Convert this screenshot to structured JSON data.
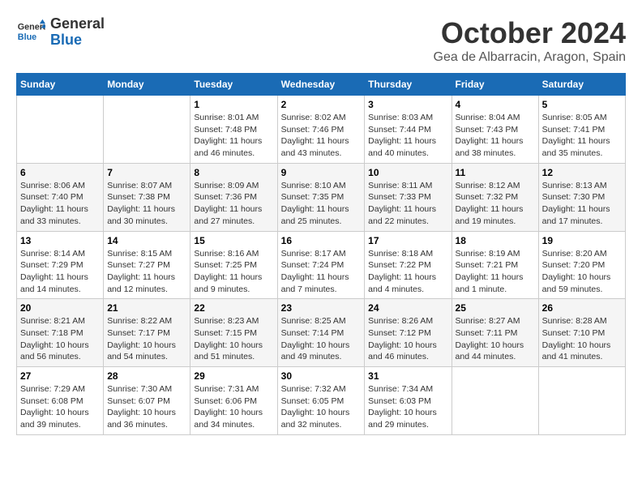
{
  "header": {
    "logo_general": "General",
    "logo_blue": "Blue",
    "month_title": "October 2024",
    "location": "Gea de Albarracin, Aragon, Spain"
  },
  "days_of_week": [
    "Sunday",
    "Monday",
    "Tuesday",
    "Wednesday",
    "Thursday",
    "Friday",
    "Saturday"
  ],
  "weeks": [
    [
      {
        "day": "",
        "info": ""
      },
      {
        "day": "",
        "info": ""
      },
      {
        "day": "1",
        "info": "Sunrise: 8:01 AM\nSunset: 7:48 PM\nDaylight: 11 hours and 46 minutes."
      },
      {
        "day": "2",
        "info": "Sunrise: 8:02 AM\nSunset: 7:46 PM\nDaylight: 11 hours and 43 minutes."
      },
      {
        "day": "3",
        "info": "Sunrise: 8:03 AM\nSunset: 7:44 PM\nDaylight: 11 hours and 40 minutes."
      },
      {
        "day": "4",
        "info": "Sunrise: 8:04 AM\nSunset: 7:43 PM\nDaylight: 11 hours and 38 minutes."
      },
      {
        "day": "5",
        "info": "Sunrise: 8:05 AM\nSunset: 7:41 PM\nDaylight: 11 hours and 35 minutes."
      }
    ],
    [
      {
        "day": "6",
        "info": "Sunrise: 8:06 AM\nSunset: 7:40 PM\nDaylight: 11 hours and 33 minutes."
      },
      {
        "day": "7",
        "info": "Sunrise: 8:07 AM\nSunset: 7:38 PM\nDaylight: 11 hours and 30 minutes."
      },
      {
        "day": "8",
        "info": "Sunrise: 8:09 AM\nSunset: 7:36 PM\nDaylight: 11 hours and 27 minutes."
      },
      {
        "day": "9",
        "info": "Sunrise: 8:10 AM\nSunset: 7:35 PM\nDaylight: 11 hours and 25 minutes."
      },
      {
        "day": "10",
        "info": "Sunrise: 8:11 AM\nSunset: 7:33 PM\nDaylight: 11 hours and 22 minutes."
      },
      {
        "day": "11",
        "info": "Sunrise: 8:12 AM\nSunset: 7:32 PM\nDaylight: 11 hours and 19 minutes."
      },
      {
        "day": "12",
        "info": "Sunrise: 8:13 AM\nSunset: 7:30 PM\nDaylight: 11 hours and 17 minutes."
      }
    ],
    [
      {
        "day": "13",
        "info": "Sunrise: 8:14 AM\nSunset: 7:29 PM\nDaylight: 11 hours and 14 minutes."
      },
      {
        "day": "14",
        "info": "Sunrise: 8:15 AM\nSunset: 7:27 PM\nDaylight: 11 hours and 12 minutes."
      },
      {
        "day": "15",
        "info": "Sunrise: 8:16 AM\nSunset: 7:25 PM\nDaylight: 11 hours and 9 minutes."
      },
      {
        "day": "16",
        "info": "Sunrise: 8:17 AM\nSunset: 7:24 PM\nDaylight: 11 hours and 7 minutes."
      },
      {
        "day": "17",
        "info": "Sunrise: 8:18 AM\nSunset: 7:22 PM\nDaylight: 11 hours and 4 minutes."
      },
      {
        "day": "18",
        "info": "Sunrise: 8:19 AM\nSunset: 7:21 PM\nDaylight: 11 hours and 1 minute."
      },
      {
        "day": "19",
        "info": "Sunrise: 8:20 AM\nSunset: 7:20 PM\nDaylight: 10 hours and 59 minutes."
      }
    ],
    [
      {
        "day": "20",
        "info": "Sunrise: 8:21 AM\nSunset: 7:18 PM\nDaylight: 10 hours and 56 minutes."
      },
      {
        "day": "21",
        "info": "Sunrise: 8:22 AM\nSunset: 7:17 PM\nDaylight: 10 hours and 54 minutes."
      },
      {
        "day": "22",
        "info": "Sunrise: 8:23 AM\nSunset: 7:15 PM\nDaylight: 10 hours and 51 minutes."
      },
      {
        "day": "23",
        "info": "Sunrise: 8:25 AM\nSunset: 7:14 PM\nDaylight: 10 hours and 49 minutes."
      },
      {
        "day": "24",
        "info": "Sunrise: 8:26 AM\nSunset: 7:12 PM\nDaylight: 10 hours and 46 minutes."
      },
      {
        "day": "25",
        "info": "Sunrise: 8:27 AM\nSunset: 7:11 PM\nDaylight: 10 hours and 44 minutes."
      },
      {
        "day": "26",
        "info": "Sunrise: 8:28 AM\nSunset: 7:10 PM\nDaylight: 10 hours and 41 minutes."
      }
    ],
    [
      {
        "day": "27",
        "info": "Sunrise: 7:29 AM\nSunset: 6:08 PM\nDaylight: 10 hours and 39 minutes."
      },
      {
        "day": "28",
        "info": "Sunrise: 7:30 AM\nSunset: 6:07 PM\nDaylight: 10 hours and 36 minutes."
      },
      {
        "day": "29",
        "info": "Sunrise: 7:31 AM\nSunset: 6:06 PM\nDaylight: 10 hours and 34 minutes."
      },
      {
        "day": "30",
        "info": "Sunrise: 7:32 AM\nSunset: 6:05 PM\nDaylight: 10 hours and 32 minutes."
      },
      {
        "day": "31",
        "info": "Sunrise: 7:34 AM\nSunset: 6:03 PM\nDaylight: 10 hours and 29 minutes."
      },
      {
        "day": "",
        "info": ""
      },
      {
        "day": "",
        "info": ""
      }
    ]
  ]
}
